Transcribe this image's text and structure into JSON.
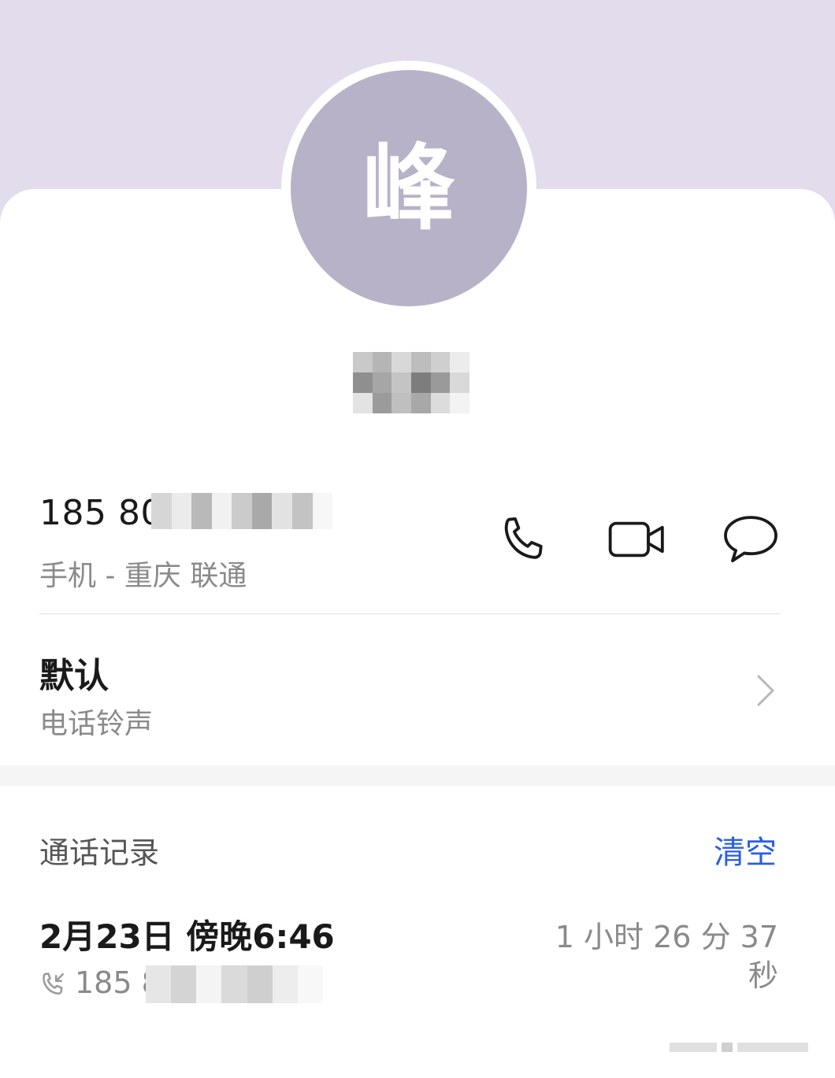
{
  "contact": {
    "avatar_char": "峰",
    "phone_partial": "185 80",
    "phone_detail": "手机 - 重庆 联通"
  },
  "ringtone": {
    "value": "默认",
    "label": "电话铃声"
  },
  "call_log": {
    "title": "通话记录",
    "clear_label": "清空",
    "entries": [
      {
        "datetime": "2月23日 傍晚6:46",
        "duration": "1 小时 26 分 37 秒",
        "number_partial": "185 8"
      }
    ]
  },
  "colors": {
    "header_bg": "#e2dced",
    "avatar_bg": "#b8b2c8",
    "accent_blue": "#2a5fe0"
  },
  "icons": {
    "call": "phone-icon",
    "video": "video-camera-icon",
    "message": "chat-bubble-icon",
    "chevron": "chevron-right-icon",
    "incoming": "incoming-call-icon"
  }
}
